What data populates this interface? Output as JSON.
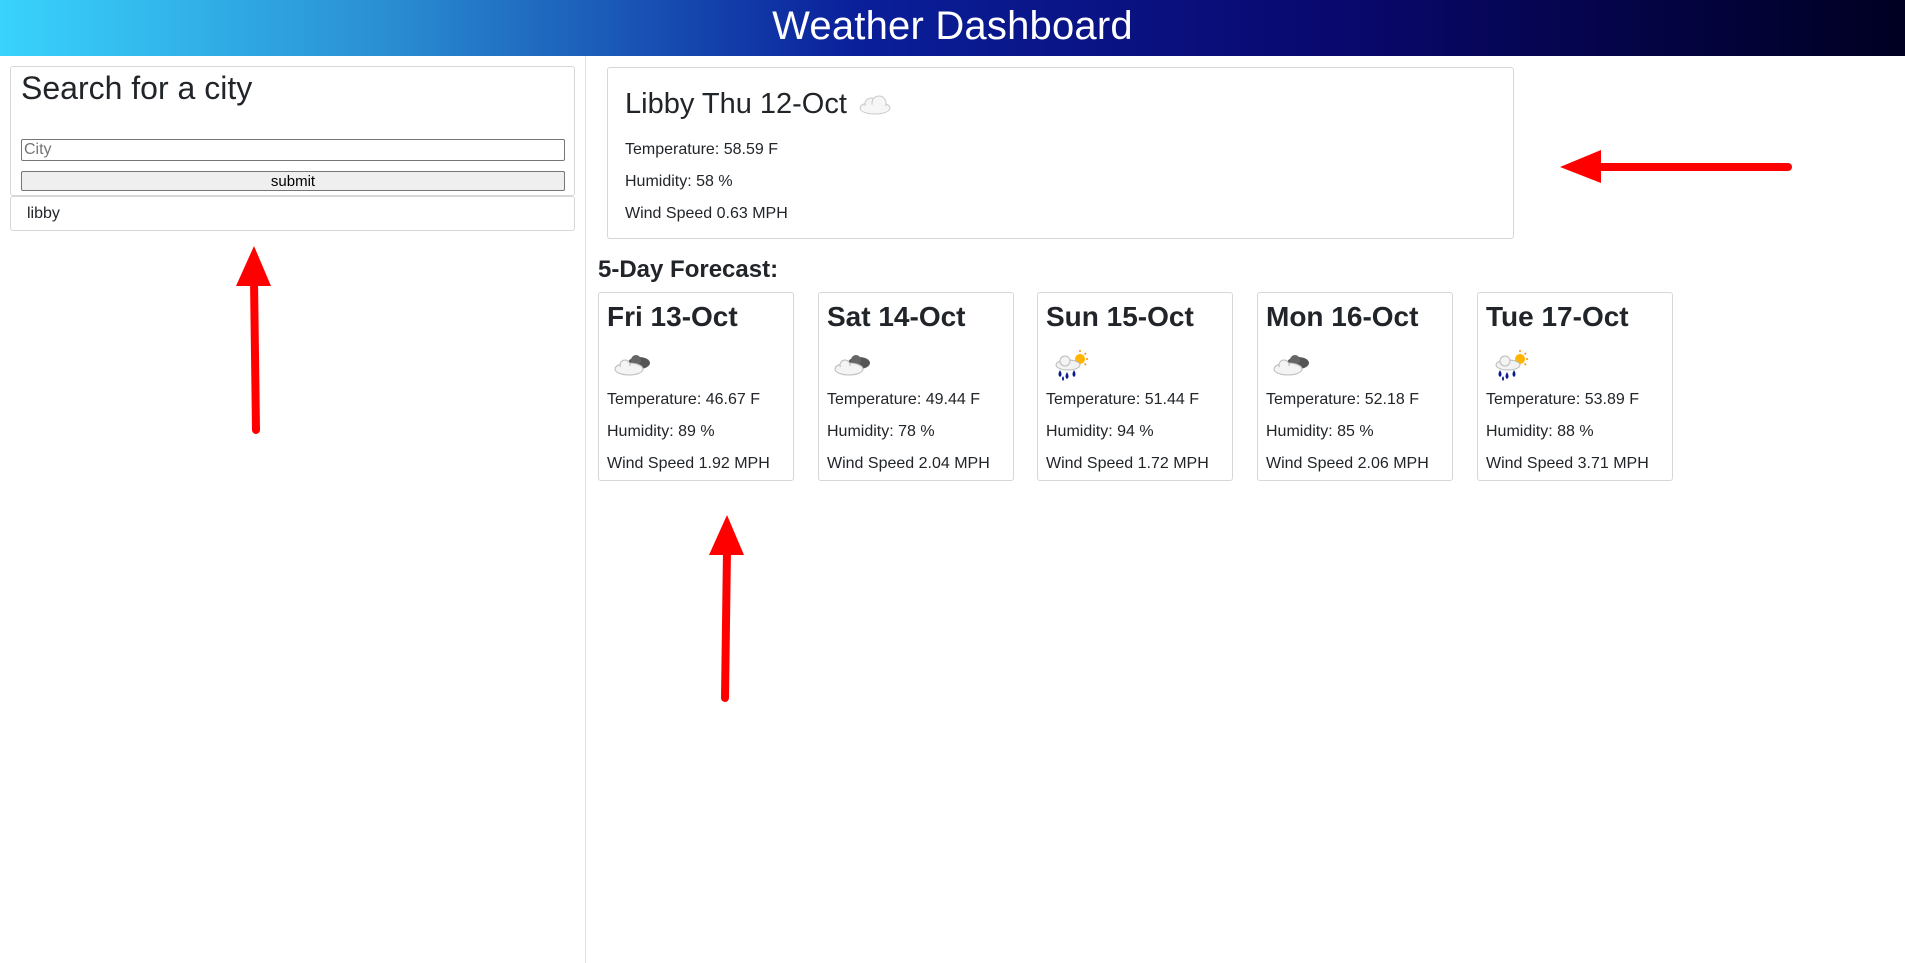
{
  "header": {
    "title": "Weather Dashboard"
  },
  "search": {
    "title": "Search for a city",
    "placeholder": "City",
    "value": "",
    "submit_label": "submit"
  },
  "history": [
    {
      "label": "libby"
    }
  ],
  "current": {
    "title": "Libby Thu 12-Oct",
    "icon": "cloud-icon",
    "temperature": "Temperature: 58.59 F",
    "humidity": "Humidity: 58 %",
    "wind": "Wind Speed 0.63 MPH"
  },
  "forecast": {
    "label": "5-Day Forecast:",
    "days": [
      {
        "day": "Fri 13-Oct",
        "icon": "cloudy-icon",
        "temperature": "Temperature: 46.67 F",
        "humidity": "Humidity: 89 %",
        "wind": "Wind Speed 1.92 MPH"
      },
      {
        "day": "Sat 14-Oct",
        "icon": "cloudy-icon",
        "temperature": "Temperature: 49.44 F",
        "humidity": "Humidity: 78 %",
        "wind": "Wind Speed 2.04 MPH"
      },
      {
        "day": "Sun 15-Oct",
        "icon": "sun-rain-icon",
        "temperature": "Temperature: 51.44 F",
        "humidity": "Humidity: 94 %",
        "wind": "Wind Speed 1.72 MPH"
      },
      {
        "day": "Mon 16-Oct",
        "icon": "cloudy-icon",
        "temperature": "Temperature: 52.18 F",
        "humidity": "Humidity: 85 %",
        "wind": "Wind Speed 2.06 MPH"
      },
      {
        "day": "Tue 17-Oct",
        "icon": "sun-rain-icon",
        "temperature": "Temperature: 53.89 F",
        "humidity": "Humidity: 88 %",
        "wind": "Wind Speed 3.71 MPH"
      }
    ]
  },
  "colors": {
    "annotation_arrow": "#ff0000",
    "header_start": "#39d3fd",
    "header_end": "#000022"
  }
}
